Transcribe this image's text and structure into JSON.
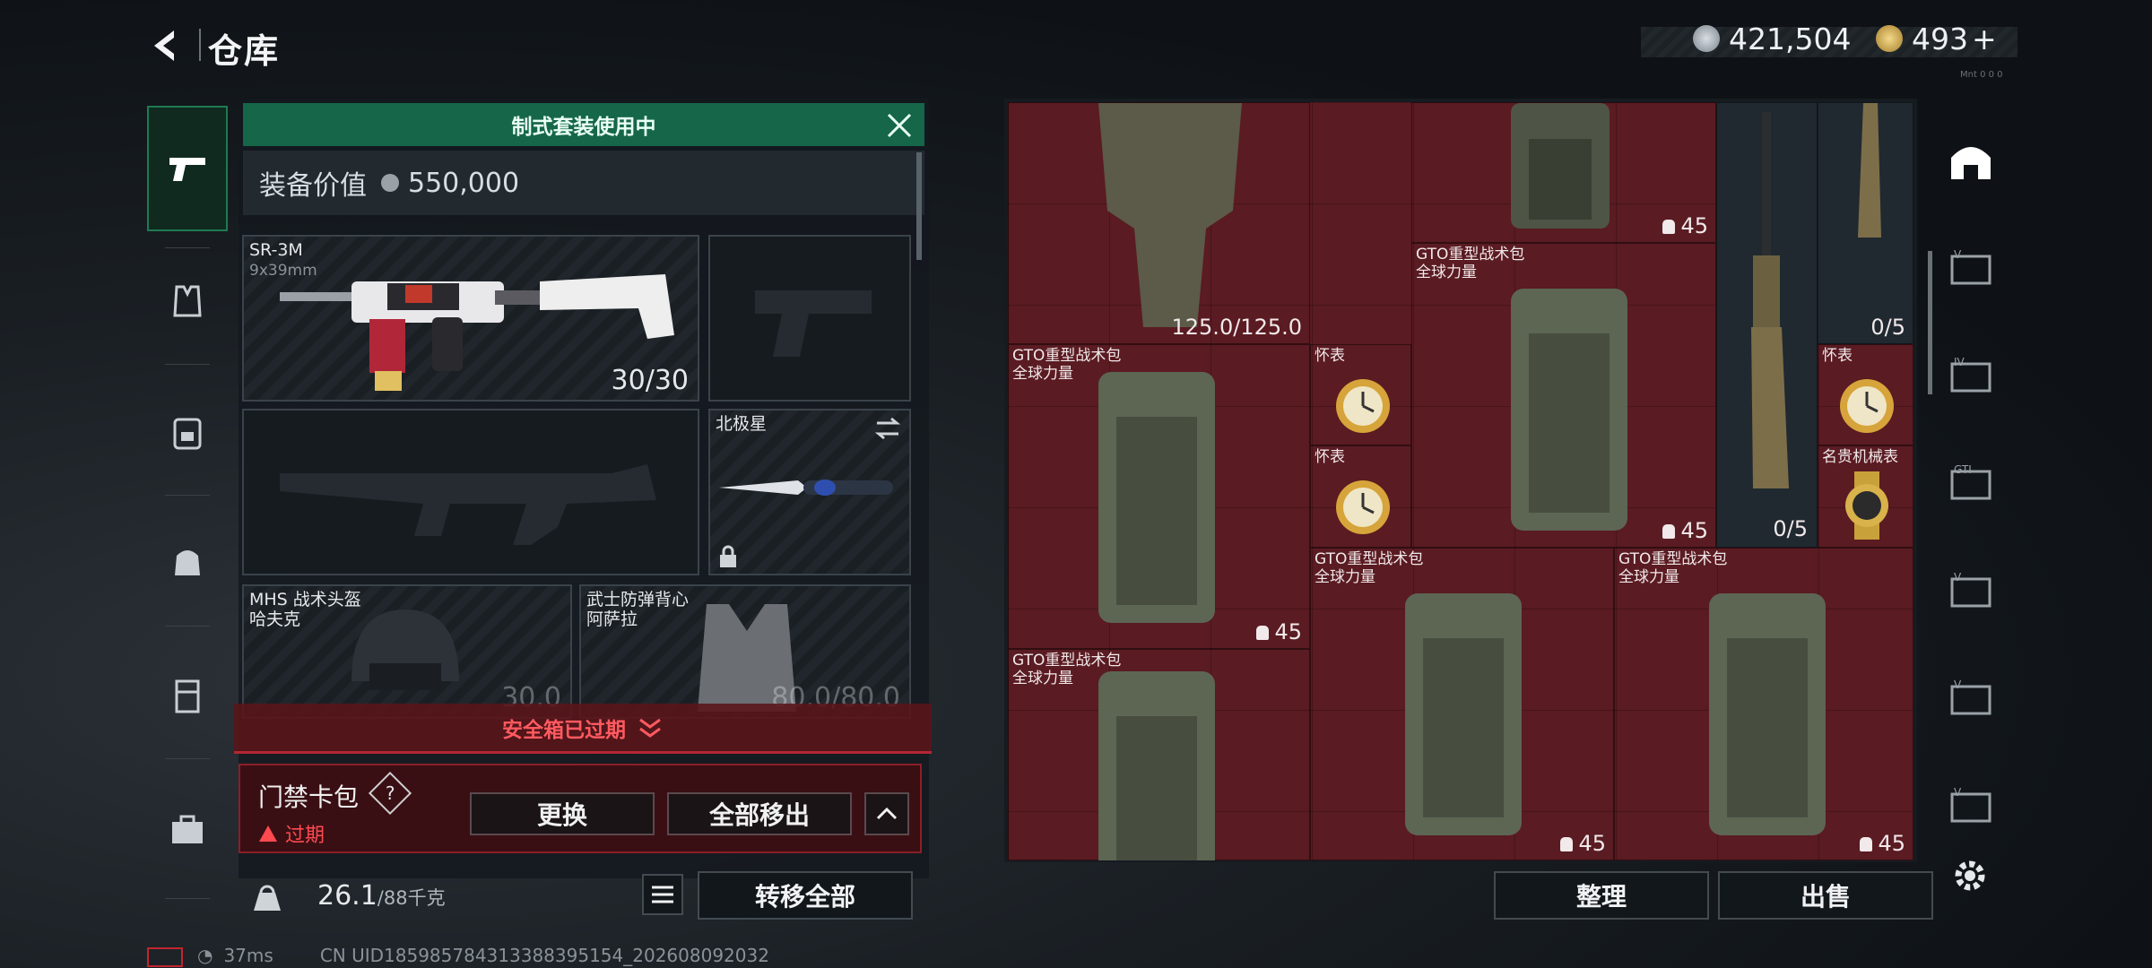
{
  "header": {
    "title": "仓库",
    "currency1": "421,504",
    "currency2": "493",
    "currency2_plus": "+",
    "small_id": "Mnt 0 0 0"
  },
  "tabs": [
    {
      "name": "weapons"
    },
    {
      "name": "vest"
    },
    {
      "name": "backpack"
    },
    {
      "name": "bag"
    },
    {
      "name": "container"
    },
    {
      "name": "case"
    }
  ],
  "loadout": {
    "banner": "制式套装使用中",
    "value_label": "装备价值",
    "value": "550,000",
    "primary": {
      "name": "SR-3M",
      "caliber": "9x39mm",
      "ammo": "30/30"
    },
    "melee": {
      "name": "北极星"
    },
    "helmet": {
      "name": "MHS 战术头盔",
      "sub": "哈夫克",
      "durability": "30.0"
    },
    "armor": {
      "name": "武士防弹背心",
      "sub": "阿萨拉",
      "durability": "80.0/80.0"
    },
    "expired_bar": "安全箱已过期",
    "card": {
      "title": "门禁卡包",
      "help": "?",
      "status": "过期",
      "btn_replace": "更换",
      "btn_move_all": "全部移出"
    },
    "weight": "26.1",
    "weight_max": "/88千克",
    "btn_transfer": "转移全部"
  },
  "stash": {
    "items": [
      {
        "name": "",
        "count": "125.0/125.0"
      },
      {
        "name": "",
        "count": "45"
      },
      {
        "name": "",
        "count": "0/5"
      },
      {
        "name": "GTO重型战术包",
        "sub": "全球力量",
        "count": "45"
      },
      {
        "name": "GTO重型战术包",
        "sub": "全球力量",
        "count": "45"
      },
      {
        "name": "怀表",
        "count": ""
      },
      {
        "name": "怀表",
        "count": ""
      },
      {
        "name": "怀表",
        "count": ""
      },
      {
        "name": "名贵机械表",
        "count": ""
      },
      {
        "name": "",
        "count": "0/5"
      },
      {
        "name": "GTO重型战术包",
        "sub": "全球力量",
        "count": "45"
      },
      {
        "name": "GTO重型战术包",
        "sub": "全球力量",
        "count": "45"
      },
      {
        "name": "GTO重型战术包",
        "sub": "全球力量",
        "count": ""
      }
    ],
    "btn_sort": "整理",
    "btn_sell": "出售"
  },
  "status": {
    "ping": "37ms",
    "uid": "CN UID185985784313388395154_202608092032"
  },
  "colors": {
    "accent": "#16664a",
    "stash_bg": "#5a1b22",
    "alert": "#ff5a5f"
  }
}
